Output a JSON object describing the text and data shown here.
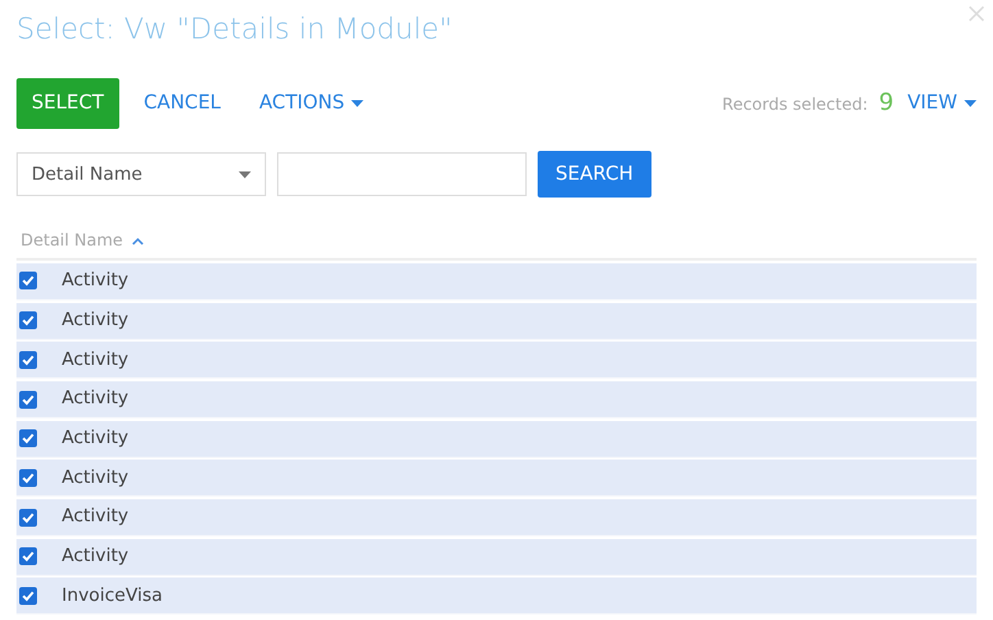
{
  "window": {
    "title": "Select: Vw \"Details in Module\""
  },
  "toolbar": {
    "select": "SELECT",
    "cancel": "CANCEL",
    "actions": "ACTIONS",
    "records_label": "Records selected:",
    "records_count": "9",
    "view": "VIEW"
  },
  "filter": {
    "column": "Detail Name",
    "search": "SEARCH"
  },
  "table": {
    "columns": [
      {
        "label": "Detail Name",
        "sort_ascending": true
      }
    ],
    "rows": [
      {
        "name": "Activity",
        "selected": true,
        "checked": true
      },
      {
        "name": "Activity",
        "selected": true,
        "checked": true
      },
      {
        "name": "Activity",
        "selected": true,
        "checked": true
      },
      {
        "name": "Activity",
        "selected": true,
        "checked": true
      },
      {
        "name": "Activity",
        "selected": true,
        "checked": true
      },
      {
        "name": "Activity",
        "selected": true,
        "checked": true
      },
      {
        "name": "Activity",
        "selected": true,
        "checked": true
      },
      {
        "name": "Activity",
        "selected": true,
        "checked": true
      },
      {
        "name": "InvoiceVisa",
        "selected": true,
        "checked": true
      }
    ]
  }
}
